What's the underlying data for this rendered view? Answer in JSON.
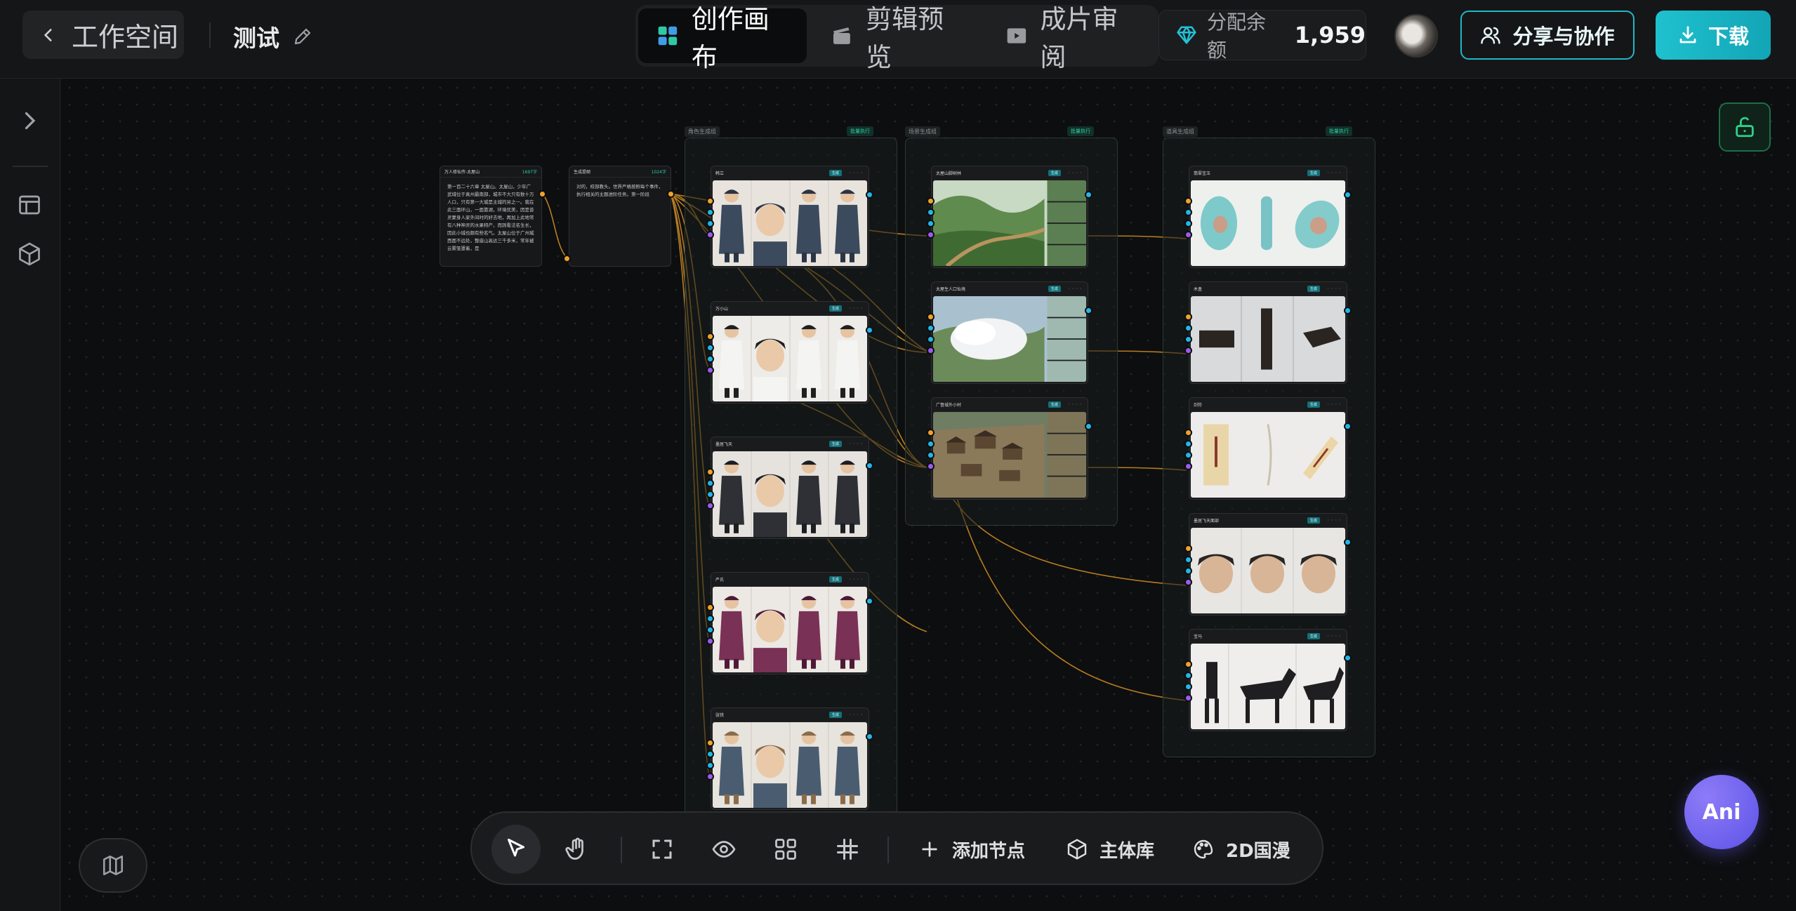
{
  "header": {
    "back_label": "工作空间",
    "project_name": "测试",
    "tabs": [
      {
        "label": "创作画布",
        "icon": "grid-canvas-icon",
        "active": true
      },
      {
        "label": "剪辑预览",
        "icon": "clapperboard-icon",
        "active": false
      },
      {
        "label": "成片审阅",
        "icon": "play-review-icon",
        "active": false
      }
    ],
    "balance_label": "分配余额",
    "balance_value": "1,959",
    "share_label": "分享与协作",
    "download_label": "下载"
  },
  "toolbar": {
    "add_node_label": "添加节点",
    "asset_library_label": "主体库",
    "style_label": "2D国漫"
  },
  "assistant": {
    "label": "Ani"
  },
  "canvas": {
    "text_nodes": [
      {
        "title": "万人修仙传-太屋山",
        "tag": "1697字",
        "body": "第一百二十六章 太屋山。太屋山，少年广武域位于真州最南部，城市不大只有数十万人口，只有第一大城是主城的另之一。我在此三面环山，一面靠湖，环境优美，因是普灵蒙身人家外间时的好去地，再加上此地常有八种神灵的水果特产，而则看法名生长，因此小城也颇有些名气。太屋山位于广州城西面不远处，整座山高达三千多米，常年被云雾笼罩着，是"
      },
      {
        "title": "生成提纲",
        "tag": "1024字",
        "body": "对的，校部教头。世界严格按照每个事件，执行相关的主题进阶任务。第一阶段"
      }
    ],
    "characters": [
      {
        "title": "韩立"
      },
      {
        "title": "万小山"
      },
      {
        "title": "墨居飞天"
      },
      {
        "title": "严氏"
      },
      {
        "title": "张铁"
      }
    ],
    "scenes": [
      {
        "title": "太屋山脚树林"
      },
      {
        "title": "太屋生人口仙境"
      },
      {
        "title": "广督城外小村"
      }
    ],
    "props": [
      {
        "title": "翡翠宝玉"
      },
      {
        "title": "木盒"
      },
      {
        "title": "剑符"
      },
      {
        "title": "墨居飞天面部"
      },
      {
        "title": "宝马"
      }
    ],
    "group_labels": [
      "角色生成组",
      "场景生成组",
      "道具生成组"
    ],
    "group_badge": "批量执行",
    "node_pill": "生成"
  }
}
